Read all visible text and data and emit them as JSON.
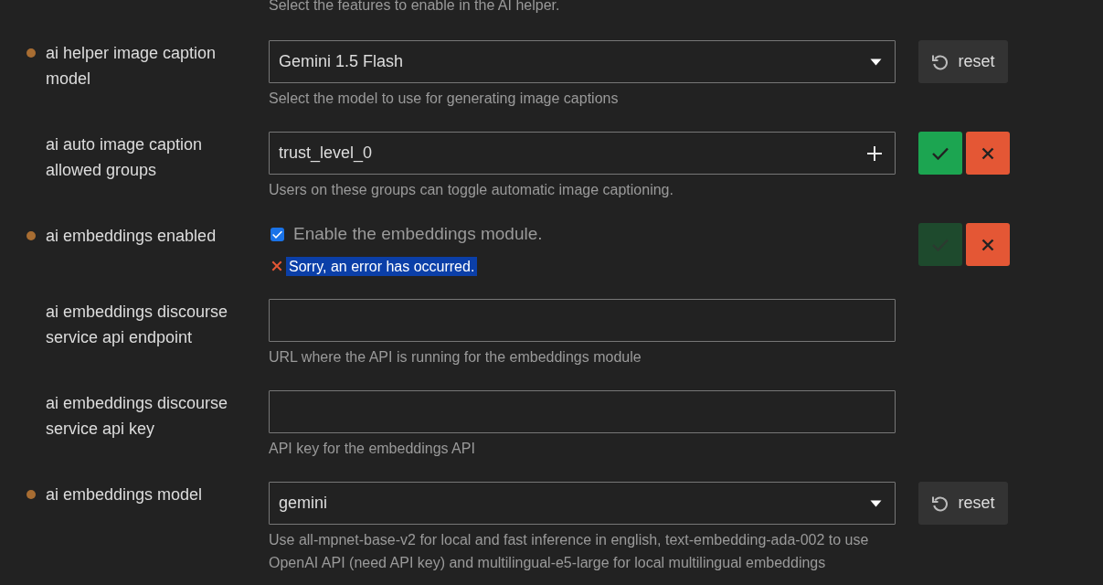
{
  "intro_description": "Select the features to enable in the AI helper.",
  "settings": [
    {
      "kind": "select",
      "label": "ai helper image caption model",
      "modified": true,
      "value": "Gemini 1.5 Flash",
      "description": "Select the model to use for generating image captions",
      "actions": {
        "kind": "reset",
        "label": "reset"
      }
    },
    {
      "kind": "group_list",
      "label": "ai auto image caption allowed groups",
      "modified": false,
      "value": "trust_level_0",
      "description": "Users on these groups can toggle automatic image captioning.",
      "actions": {
        "kind": "confirm",
        "confirm_disabled": false
      }
    },
    {
      "kind": "checkbox",
      "label": "ai embeddings enabled",
      "modified": true,
      "checked": true,
      "checkbox_label": "Enable the embeddings module.",
      "error": {
        "text": "Sorry, an error has occurred.",
        "selected": true
      },
      "actions": {
        "kind": "confirm",
        "confirm_disabled": true
      }
    },
    {
      "kind": "text",
      "label": "ai embeddings discourse service api endpoint",
      "modified": false,
      "description": "URL where the API is running for the embeddings module"
    },
    {
      "kind": "text",
      "label": "ai embeddings discourse service api key",
      "modified": false,
      "description": "API key for the embeddings API"
    },
    {
      "kind": "select",
      "label": "ai embeddings model",
      "modified": true,
      "value": "gemini",
      "description": "Use all-mpnet-base-v2 for local and fast inference in english, text-embedding-ada-002 to use OpenAI API (need API key) and multilingual-e5-large for local multilingual embeddings",
      "actions": {
        "kind": "reset",
        "label": "reset"
      }
    }
  ]
}
